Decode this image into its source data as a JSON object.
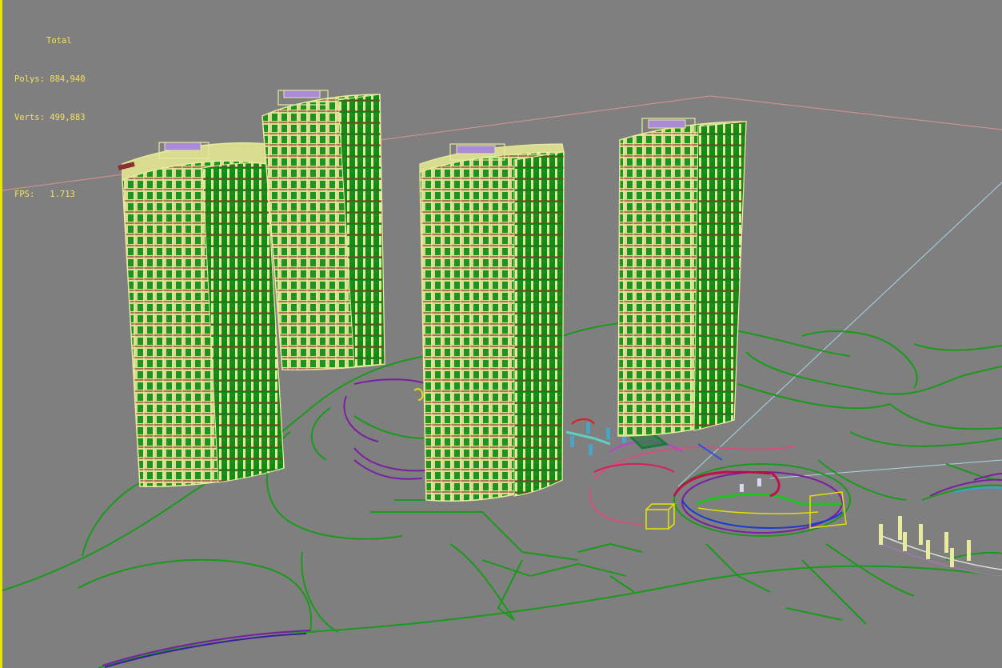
{
  "viewport": {
    "stats": {
      "title": "Total",
      "polys_label": "Polys:",
      "polys_value": "884,940",
      "verts_label": "Verts:",
      "verts_value": "499,883",
      "fps_label": "FPS:",
      "fps_value": "1.713"
    }
  },
  "colors": {
    "background": "#7f7f7f",
    "active_border": "#e6e600",
    "stats_text": "#f5e35a",
    "building_edges": "#e8eaa0",
    "building_faces": "#119911",
    "landscape_lines": "#1a9a1a",
    "grid_horizon": "#d99595"
  }
}
